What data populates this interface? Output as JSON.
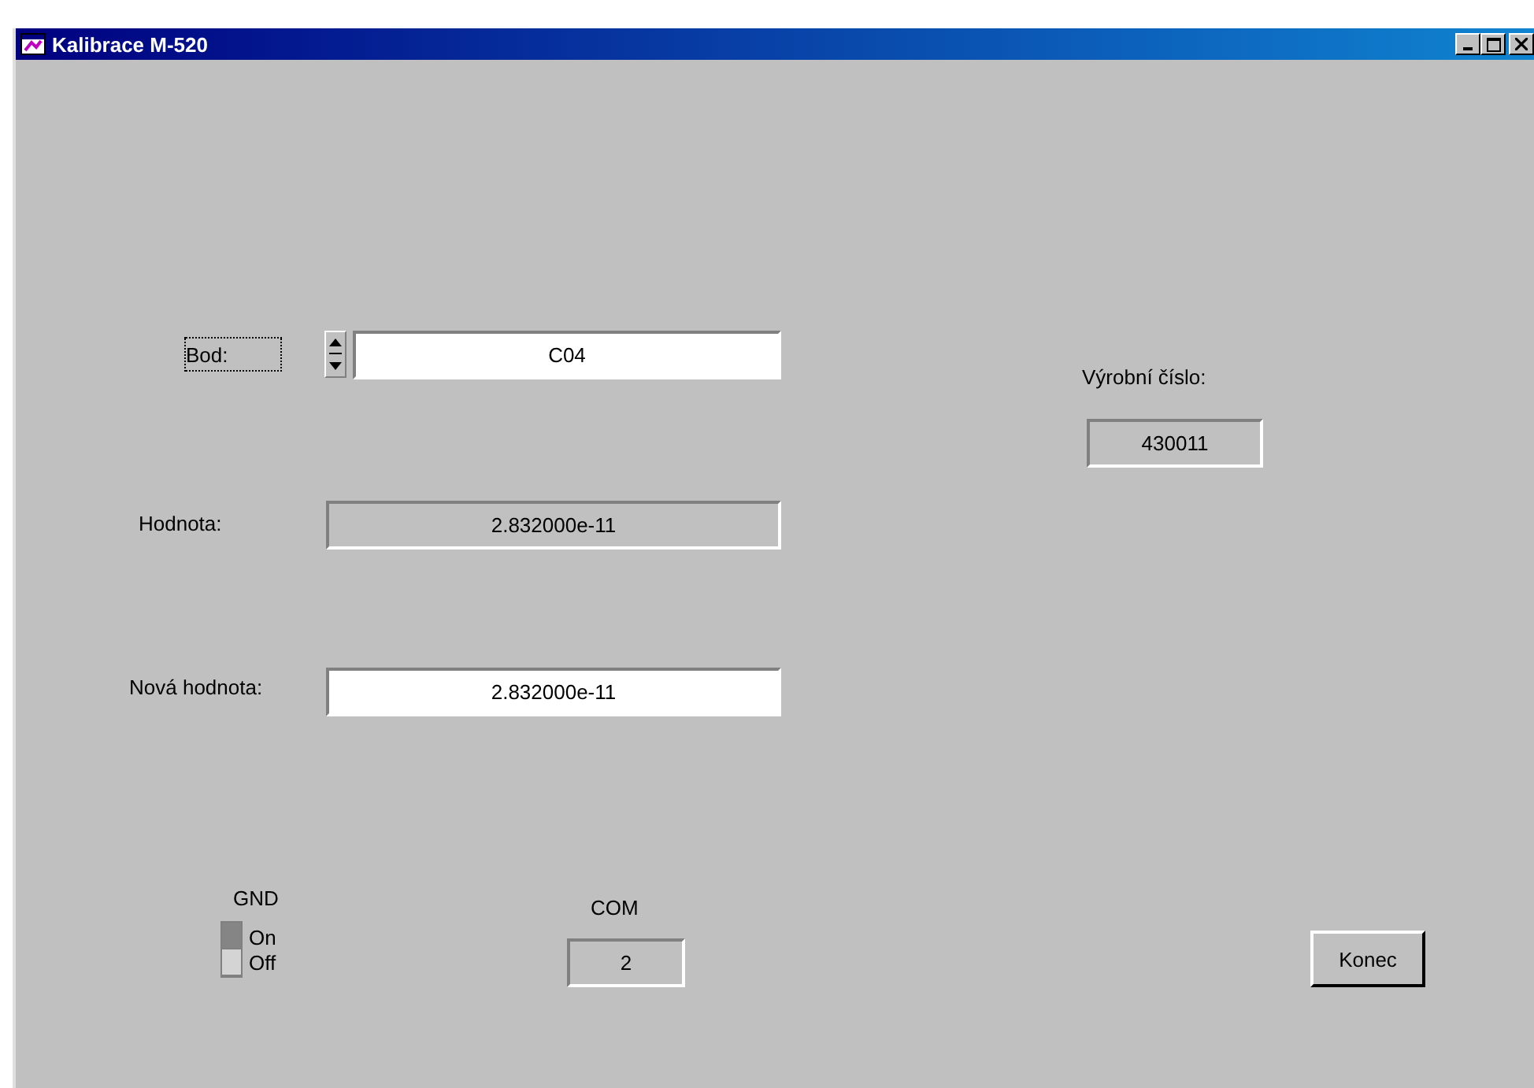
{
  "window": {
    "title": "Kalibrace M-520"
  },
  "point": {
    "label": "Bod:",
    "focused": true,
    "value": "C04"
  },
  "value": {
    "label": "Hodnota:",
    "value": "2.832000e-11"
  },
  "new_value": {
    "label": "Nová hodnota:",
    "value": "2.832000e-11"
  },
  "serial": {
    "label": "Výrobní číslo:",
    "value": "430011"
  },
  "gnd": {
    "label": "GND",
    "on": true,
    "on_label": "On",
    "off_label": "Off"
  },
  "com": {
    "label": "COM",
    "value": "2"
  },
  "buttons": [
    "Konec"
  ]
}
